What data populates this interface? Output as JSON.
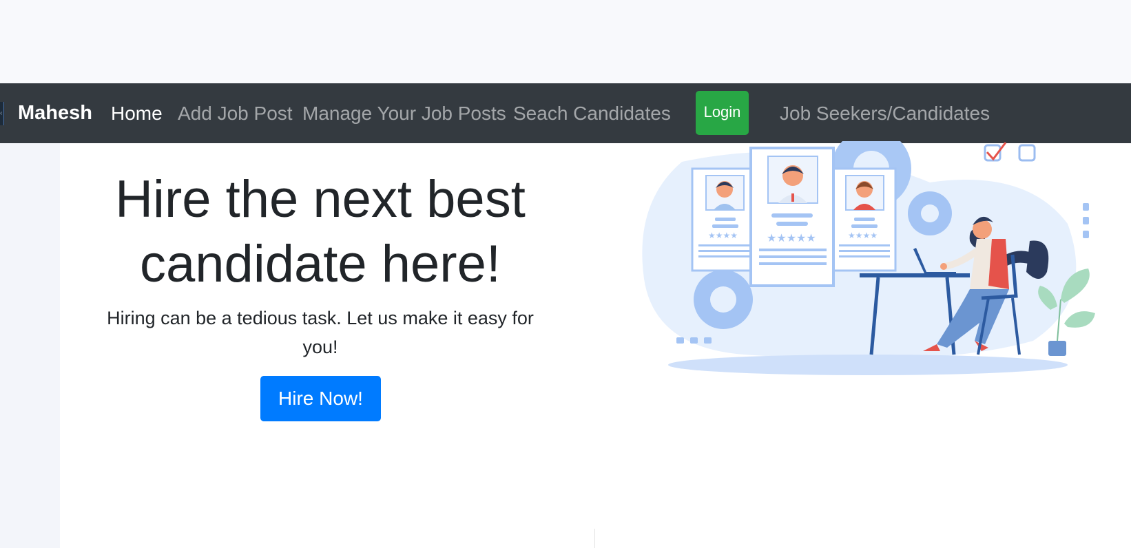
{
  "navbar": {
    "brand": "Mahesh",
    "links": [
      {
        "label": "Home",
        "active": true
      },
      {
        "label": "Add Job Post",
        "active": false
      },
      {
        "label": "Manage Your Job Posts",
        "active": false
      },
      {
        "label": "Seach Candidates",
        "active": false
      }
    ],
    "login_label": "Login",
    "job_seekers_label": "Job Seekers/Candidates"
  },
  "hero": {
    "title": "Hire the next best candidate here!",
    "subtitle": "Hiring can be a tedious task. Let us make it easy for you!",
    "cta_label": "Hire Now!"
  },
  "colors": {
    "navbar_bg": "#343a40",
    "login_green": "#28a745",
    "cta_blue": "#007bff",
    "illustration_blue": "#a4c4f4"
  },
  "illustration": {
    "icons": [
      "candidate-card-icon",
      "gear-icon",
      "checkbox-icon",
      "woman-at-laptop-icon",
      "plant-icon"
    ]
  }
}
